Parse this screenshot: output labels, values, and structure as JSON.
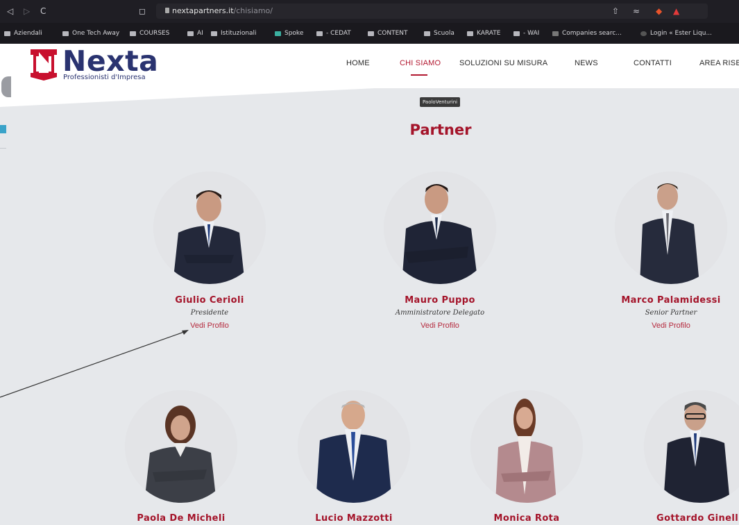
{
  "browser": {
    "url_host": "nextapartners.it",
    "url_path": "/chisiamo/",
    "bookmarks": [
      "Aziendali",
      "One Tech Away",
      "COURSES",
      "AI",
      "Istituzionali",
      "Spoke",
      "- CEDAT",
      "CONTENT",
      "Scuola",
      "KARATE",
      "- WAI",
      "Companies searc...",
      "Login « Ester Liqu..."
    ]
  },
  "site": {
    "logo_word": "Nexta",
    "logo_sub": "Professionisti d'Impresa",
    "nav": [
      "HOME",
      "CHI SIAMO",
      "SOLUZIONI SU MISURA",
      "NEWS",
      "CONTATTI",
      "AREA RISE"
    ],
    "active_nav": "CHI SIAMO",
    "tooltip": "PaoloVenturini",
    "section_title": "Partner"
  },
  "partners": [
    {
      "name": "Giulio Cerioli",
      "role": "Presidente",
      "link": "Vedi Profilo"
    },
    {
      "name": "Mauro Puppo",
      "role": "Amministratore Delegato",
      "link": "Vedi Profilo"
    },
    {
      "name": "Marco Palamidessi",
      "role": "Senior Partner",
      "link": "Vedi Profilo"
    },
    {
      "name": "Paola De Micheli"
    },
    {
      "name": "Lucio Mazzotti"
    },
    {
      "name": "Monica Rota"
    },
    {
      "name": "Gottardo Ginell"
    }
  ],
  "colors": {
    "brand_red": "#a4142a",
    "brand_navy": "#2a3370",
    "page_bg": "#e6e8eb"
  }
}
